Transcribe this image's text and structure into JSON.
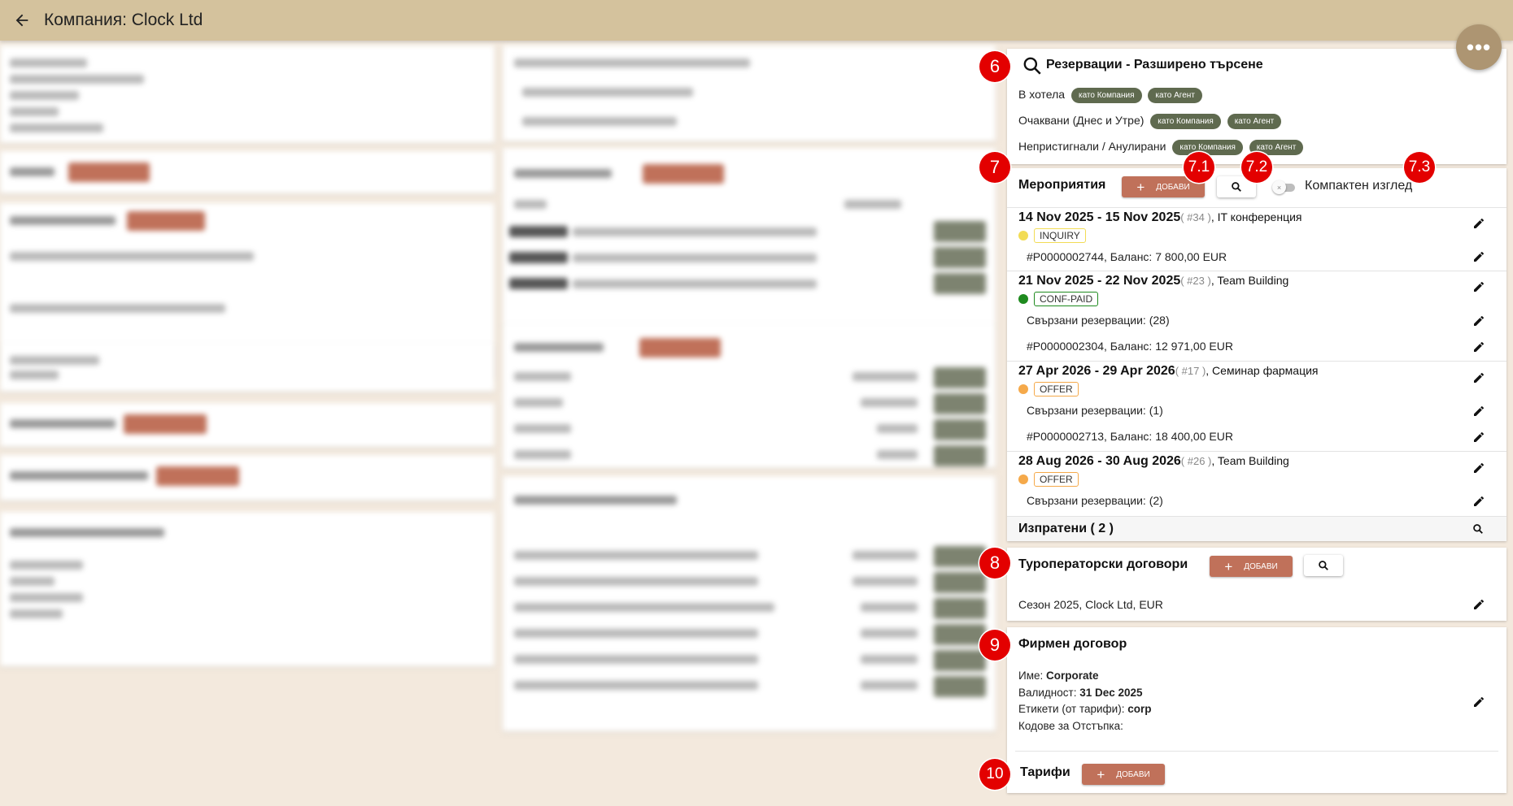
{
  "header": {
    "title": "Компания: Clock Ltd"
  },
  "colors": {
    "header_bg": "#d4c29d",
    "accent": "#c0715a",
    "chip": "#5f6a4f",
    "badge": "#e30000",
    "fab": "#ad9572"
  },
  "fab": {
    "label": "•••"
  },
  "reservations": {
    "badge": "6",
    "title": "Резервации - Разширено търсене",
    "rows": [
      {
        "label": "В хотела",
        "chips": [
          "като Компания",
          "като Агент"
        ]
      },
      {
        "label": "Очаквани (Днес и Утре)",
        "chips": [
          "като Компания",
          "като Агент"
        ]
      },
      {
        "label": "Непристигнали / Анулирани",
        "chips": [
          "като Компания",
          "като Агент"
        ]
      }
    ]
  },
  "events": {
    "badge": "7",
    "badge_add": "7.1",
    "badge_search": "7.2",
    "badge_compact": "7.3",
    "title": "Мероприятия",
    "add_label": "ДОБАВИ",
    "compact_label": "Компактен изглед",
    "compact_on": false,
    "items": [
      {
        "dates": "14 Nov 2025 - 15 Nov 2025",
        "id": "( #34 )",
        "name": ", IT конференция",
        "status": "INQUIRY",
        "status_color": "#f2dc55",
        "lines": [
          "#P0000002744, Баланс: 7 800,00 EUR"
        ]
      },
      {
        "dates": "21 Nov 2025 - 22 Nov 2025",
        "id": "( #23 )",
        "name": ", Team Building",
        "status": "CONF-PAID",
        "status_color": "#1e8a1e",
        "lines": [
          "Свързани резервации: (28)",
          "#P0000002304, Баланс: 12 971,00 EUR"
        ]
      },
      {
        "dates": "27 Apr 2026 - 29 Apr 2026",
        "id": "( #17 )",
        "name": ", Семинар фармация",
        "status": "OFFER",
        "status_color": "#f5a94a",
        "lines": [
          "Свързани резервации: (1)",
          "#P0000002713, Баланс: 18 400,00 EUR"
        ]
      },
      {
        "dates": "28 Aug 2026 - 30 Aug 2026",
        "id": "( #26 )",
        "name": ", Team Building",
        "status": "OFFER",
        "status_color": "#f5a94a",
        "lines": [
          "Свързани резервации: (2)"
        ]
      }
    ],
    "sent_label": "Изпратени ( 2 )"
  },
  "touroperator": {
    "badge": "8",
    "title": "Туроператорски договори",
    "add_label": "ДОБАВИ",
    "item": "Сезон 2025, Clock Ltd, EUR"
  },
  "company_contract": {
    "badge": "9",
    "title": "Фирмен договор",
    "name_label": "Име:",
    "name_value": "Corporate",
    "validity_label": "Валидност:",
    "validity_value": "31 Dec 2025",
    "tags_label": "Етикети (от тарифи):",
    "tags_value": "corp",
    "discount_label": "Кодове за Отстъпка:"
  },
  "rates": {
    "badge": "10",
    "title": "Тарифи",
    "add_label": "ДОБАВИ"
  }
}
